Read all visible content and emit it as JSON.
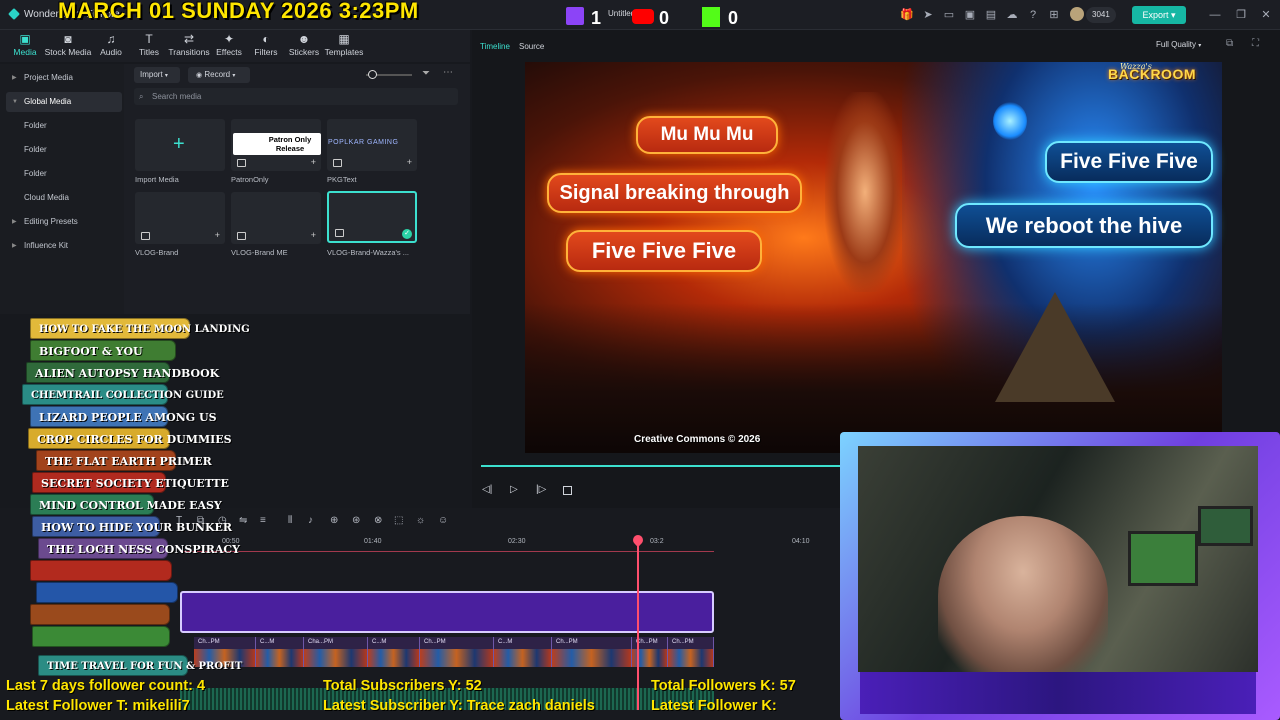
{
  "titlebar": {
    "app_name": "Wondershare Filmora",
    "overlay_datetime": "MARCH 01 SUNDAY 2026 3:23PM",
    "untitled": "Untitled",
    "twitch_count": "1",
    "youtube_count": "0",
    "kick_count": "0",
    "credits": "3041",
    "export_label": "Export"
  },
  "toolbar": {
    "items": [
      {
        "label": "Media",
        "icon": "media-icon"
      },
      {
        "label": "Stock Media",
        "icon": "stock-media-icon"
      },
      {
        "label": "Audio",
        "icon": "audio-icon"
      },
      {
        "label": "Titles",
        "icon": "titles-icon"
      },
      {
        "label": "Transitions",
        "icon": "transitions-icon"
      },
      {
        "label": "Effects",
        "icon": "effects-icon"
      },
      {
        "label": "Filters",
        "icon": "filters-icon"
      },
      {
        "label": "Stickers",
        "icon": "stickers-icon"
      },
      {
        "label": "Templates",
        "icon": "templates-icon"
      }
    ]
  },
  "sidebar": {
    "items": [
      {
        "label": "Project Media"
      },
      {
        "label": "Global Media"
      },
      {
        "label": "Folder"
      },
      {
        "label": "Folder"
      },
      {
        "label": "Folder"
      },
      {
        "label": "Cloud Media"
      },
      {
        "label": "Editing Presets"
      },
      {
        "label": "Influence Kit"
      }
    ]
  },
  "media": {
    "import_label": "Import",
    "record_label": "Record",
    "search_placeholder": "Search media",
    "items": [
      {
        "label": "Import Media"
      },
      {
        "label": "PatronOnly",
        "thumb_text": "Patron Only Release"
      },
      {
        "label": "PKGText",
        "thumb_text": "POPLKAR GAMING"
      },
      {
        "label": "VLOG-Brand"
      },
      {
        "label": "VLOG-Brand ME"
      },
      {
        "label": "VLOG-Brand-Wazza's ..."
      }
    ]
  },
  "preview": {
    "tab_timeline": "Timeline",
    "tab_source": "Source",
    "quality": "Full Quality",
    "bubbles": {
      "mu": "Mu Mu Mu",
      "signal": "Signal breaking through",
      "five_left": "Five Five Five",
      "five_right": "Five Five Five",
      "reboot": "We reboot the hive"
    },
    "logo_top": "Wazza's",
    "logo_bottom": "BACKROOM",
    "copyright": "Creative Commons © 2026"
  },
  "timeline": {
    "ruler": [
      "00:50",
      "01:40",
      "02:30",
      "03:2",
      "04:10"
    ],
    "clip_labels": [
      "Ch...PM",
      "C...M",
      "Cha...PM",
      "C...M",
      "Ch...PM",
      "C...M",
      "Ch...PM",
      "Ch...PM",
      "Ch...PM"
    ]
  },
  "books": [
    {
      "title": "HOW TO FAKE THE MOON LANDING",
      "color": "#e2b93a"
    },
    {
      "title": "BIGFOOT & YOU",
      "color": "#3f7d32"
    },
    {
      "title": "ALIEN AUTOPSY HANDBOOK",
      "color": "#2f6a3a"
    },
    {
      "title": "CHEMTRAIL COLLECTION GUIDE",
      "color": "#2a8c86"
    },
    {
      "title": "LIZARD PEOPLE AMONG US",
      "color": "#3e73b5"
    },
    {
      "title": "CROP CIRCLES FOR DUMMIES",
      "color": "#d8ab2c"
    },
    {
      "title": "THE FLAT EARTH PRIMER",
      "color": "#a2431c"
    },
    {
      "title": "SECRET SOCIETY ETIQUETTE",
      "color": "#b02a1f"
    },
    {
      "title": "MIND CONTROL MADE EASY",
      "color": "#2b7d55"
    },
    {
      "title": "HOW TO HIDE YOUR BUNKER",
      "color": "#3d5da3"
    },
    {
      "title": "THE LOCH NESS CONSPIRACY",
      "color": "#6b4a8f"
    },
    {
      "title": "",
      "color": "#b22a1e"
    },
    {
      "title": "",
      "color": "#2456a8"
    },
    {
      "title": "",
      "color": "#9a4a1c"
    },
    {
      "title": "",
      "color": "#3b8a36"
    },
    {
      "title": "TIME TRAVEL FOR FUN & PROFIT",
      "color": "#2b8c84"
    }
  ],
  "stats": {
    "last7": "Last 7 days follower count: 4",
    "latest_twitch": "Latest Follower T: mikelili7",
    "total_subs_y": "Total Subscribers Y: 52",
    "latest_sub_y": "Latest Subscriber Y: Trace zach daniels",
    "total_followers_k": "Total Followers K: 57",
    "latest_follower_k": "Latest Follower K:"
  },
  "colors": {
    "accent": "#16b7a4",
    "playhead": "#ff4f6d",
    "overlay_text": "#ffe600"
  }
}
